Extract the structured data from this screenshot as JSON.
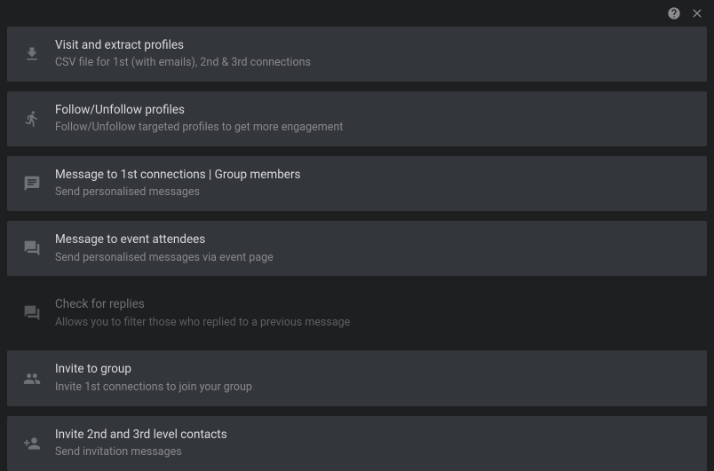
{
  "topbar": {
    "help": "help",
    "close": "close"
  },
  "items": [
    {
      "title": "Visit and extract profiles",
      "subtitle": "CSV file for 1st (with emails), 2nd & 3rd connections",
      "disabled": false,
      "icon": "download"
    },
    {
      "title": "Follow/Unfollow profiles",
      "subtitle": "Follow/Unfollow targeted profiles to get more engagement",
      "disabled": false,
      "icon": "run"
    },
    {
      "title": "Message to 1st connections | Group members",
      "subtitle": "Send personalised messages",
      "disabled": false,
      "icon": "message"
    },
    {
      "title": "Message to event attendees",
      "subtitle": "Send personalised messages via event page",
      "disabled": false,
      "icon": "messages"
    },
    {
      "title": "Check for replies",
      "subtitle": "Allows you to filter those who replied to a previous message",
      "disabled": true,
      "icon": "messages"
    },
    {
      "title": "Invite to group",
      "subtitle": "Invite 1st connections to join your group",
      "disabled": false,
      "icon": "group"
    },
    {
      "title": "Invite 2nd and 3rd level contacts",
      "subtitle": "Send invitation messages",
      "disabled": false,
      "icon": "person-add"
    }
  ]
}
